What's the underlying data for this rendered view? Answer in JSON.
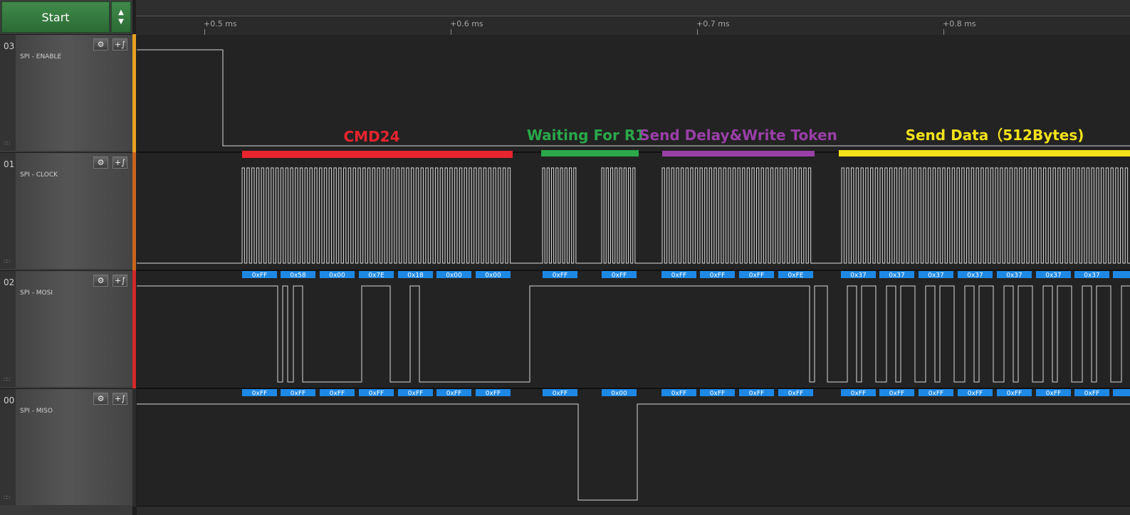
{
  "start_label": "Start",
  "arrow_up": "▲",
  "arrow_down": "▼",
  "timeline": {
    "ticks": [
      "+0.5 ms",
      "+0.6 ms",
      "+0.7 ms",
      "+0.8 ms"
    ]
  },
  "channels": [
    {
      "num": "03",
      "name": "SPI - ENABLE",
      "color": "#e8a020"
    },
    {
      "num": "01",
      "name": "SPI - CLOCK",
      "color": "#c8641e"
    },
    {
      "num": "02",
      "name": "SPI - MOSI",
      "color": "#d02828"
    },
    {
      "num": "00",
      "name": "SPI - MISO",
      "color": "#303030"
    }
  ],
  "icons": {
    "settings": "gear-icon",
    "add_analyzer": "add-analyzer-icon"
  },
  "annotations": [
    {
      "text": "CMD24",
      "color": "#e8242e"
    },
    {
      "text": "Waiting For R1",
      "color": "#2aa84a"
    },
    {
      "text": "Send Delay&Write Token",
      "color": "#9a3fa8"
    },
    {
      "text": "Send Data（512Bytes)",
      "color": "#f2e21a"
    }
  ],
  "mosi_bytes": [
    "0xFF",
    "0x58",
    "0x00",
    "0x7E",
    "0x18",
    "0x00",
    "0x00",
    "0xFF",
    "0xFF",
    "0xFF",
    "0xFF",
    "0xFF",
    "0xFE",
    "0x37",
    "0x37",
    "0x37",
    "0x37",
    "0x37",
    "0x37",
    "0x37"
  ],
  "miso_bytes": [
    "0xFF",
    "0xFF",
    "0xFF",
    "0xFF",
    "0xFF",
    "0xFF",
    "0xFF",
    "0xFF",
    "0x00",
    "0xFF",
    "0xFF",
    "0xFF",
    "0xFF",
    "0xFF",
    "0xFF",
    "0xFF",
    "0xFF",
    "0xFF",
    "0xFF",
    "0xFF"
  ]
}
